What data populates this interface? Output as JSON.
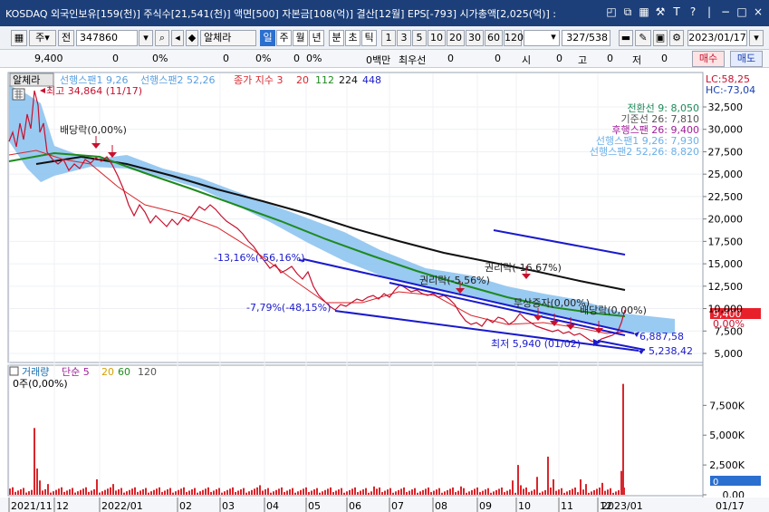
{
  "window": {
    "title": "KOSDAQ 외국인보유[159(천)] 주식수[21,541(천)] 액면[500] 자본금[108(억)] 결산[12월] EPS[-793] 시가총액[2,025(억)] :"
  },
  "toolbar": {
    "type_label": "주",
    "prev_label": "전",
    "code": "347860",
    "stock_name": "알체라",
    "period_labels": [
      "일",
      "주",
      "월",
      "년",
      "분",
      "초",
      "틱"
    ],
    "interval_labels": [
      "1",
      "3",
      "5",
      "10",
      "20",
      "30",
      "60",
      "120"
    ],
    "count": "327",
    "total": "/538",
    "date": "2023/01/17"
  },
  "quote": {
    "price": "9,400",
    "change": "0",
    "change_pct": "0%",
    "value2": "0",
    "pct2": "0%",
    "value3": "0",
    "pct3": "0%",
    "value4": "0백만",
    "priority_label": "최우선",
    "value5": "0",
    "value6": "0",
    "open_label": "시",
    "open_value": "0",
    "high_label": "고",
    "high_value": "0",
    "low_label": "저",
    "low_value": "0",
    "buy_label": "매수",
    "sell_label": "매도"
  },
  "legend": {
    "stock_name": "알체라",
    "lead1": "선행스팬1 9,26",
    "lead2": "선행스팬2 52,26",
    "ma_title": "종가 지수 3",
    "ma20": "20",
    "ma112": "112",
    "ma224": "224",
    "ma448": "448",
    "lc": "LC:58,25",
    "hc": "HC:-73,04"
  },
  "ichimoku": {
    "conversion": "전환선 9: 8,050",
    "base": "기준선 26: 7,810",
    "lagging": "후행스팬 26: 9,400",
    "lead1": "선행스팬1 9,26: 7,930",
    "lead2": "선행스팬2 52,26: 8,820"
  },
  "annotations": {
    "high": "최고 34,864 (11/17)",
    "dividend": "배당락(0,00%)",
    "drop1": "-13,16%(-56,16%)",
    "drop2": "-7,79%(-48,15%)",
    "rights1": "권리락(-5,56%)",
    "rights2": "권리락(-16,67%)",
    "free_rights": "무상증자(0,00%)",
    "dividend2": "배당락(0,00%)",
    "low": "최저 5,940 (01/02)",
    "line1_value": "6,887,58",
    "line2_value": "5,238,42",
    "current_price": "9,400",
    "current_pct": "0,00%"
  },
  "price_axis": [
    "32,500",
    "30,000",
    "27,500",
    "25,000",
    "22,500",
    "20,000",
    "17,500",
    "15,000",
    "12,500",
    "10,000",
    "7,500",
    "5,000"
  ],
  "volume_legend": {
    "title": "거래량",
    "ma_label": "단순 5",
    "ma20": "20",
    "ma60": "60",
    "ma120": "120",
    "current": "0주(0,00%)"
  },
  "volume_axis": [
    "7,500K",
    "5,000K",
    "2,500K",
    "0,00"
  ],
  "volume_current": "0",
  "date_axis": [
    "2021/11",
    "12",
    "2022/01",
    "02",
    "03",
    "04",
    "05",
    "06",
    "07",
    "08",
    "09",
    "10",
    "11",
    "12",
    "2023/01"
  ],
  "date_right": "01/17",
  "colors": {
    "title_bg": "#1c3f7a",
    "price_line": "#c8102e",
    "ma20": "#d9262c",
    "ma112": "#1e8a1e",
    "ma224": "#111111",
    "cloud": "#8ec4f0",
    "trend": "#1a1acc",
    "volume": "#d9262c"
  },
  "chart_data": {
    "type": "line",
    "ylim": [
      5000,
      34864
    ],
    "price_points": [
      [
        "2021-11",
        27500
      ],
      [
        "2021-11-17",
        34864
      ],
      [
        "2021-12",
        28000
      ],
      [
        "2022-01",
        26500
      ],
      [
        "2022-02",
        22000
      ],
      [
        "2022-03",
        20000
      ],
      [
        "2022-04",
        21000
      ],
      [
        "2022-05",
        17500
      ],
      [
        "2022-06",
        12000
      ],
      [
        "2022-07",
        9000
      ],
      [
        "2022-08",
        11000
      ],
      [
        "2022-09",
        10500
      ],
      [
        "2022-10",
        7000
      ],
      [
        "2022-11",
        8000
      ],
      [
        "2022-12",
        7000
      ],
      [
        "2023-01-02",
        5940
      ],
      [
        "2023-01-17",
        9400
      ]
    ]
  }
}
